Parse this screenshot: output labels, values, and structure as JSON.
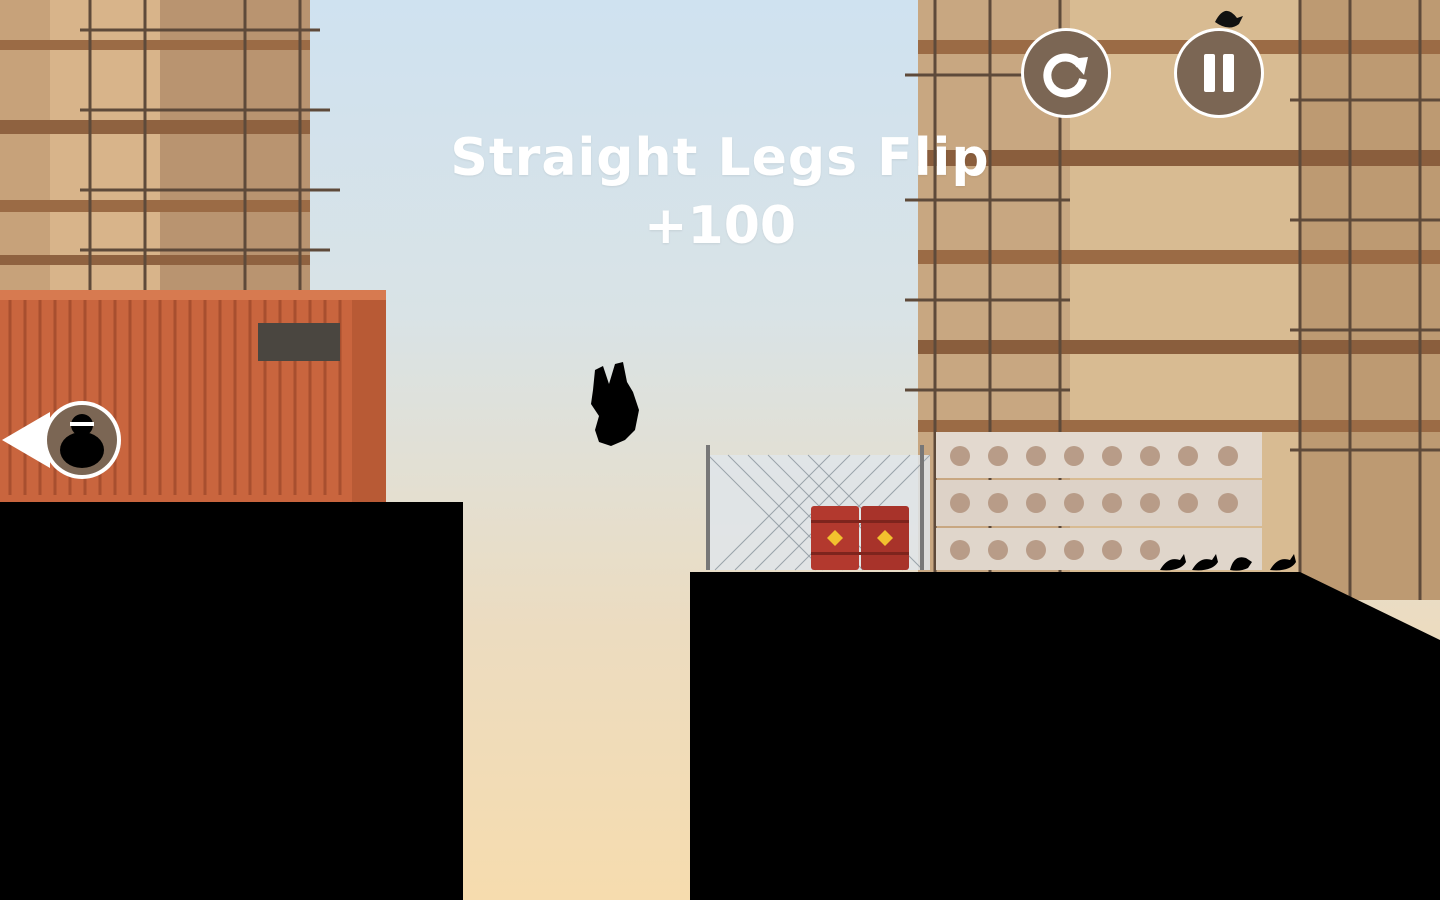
{
  "hud": {
    "restart_icon": "restart-icon",
    "pause_icon": "pause-icon",
    "button_color": "#7b6654"
  },
  "trick": {
    "name": "Straight Legs Flip",
    "score": "+100"
  },
  "chaser_indicator": {
    "icon": "chaser-indicator-icon",
    "direction": "left"
  },
  "colors": {
    "sky_top": "#cfe2f0",
    "sky_bottom": "#f6dcae",
    "container": "#c9653e",
    "silhouette": "#000000",
    "barrel": "#b3392e"
  }
}
